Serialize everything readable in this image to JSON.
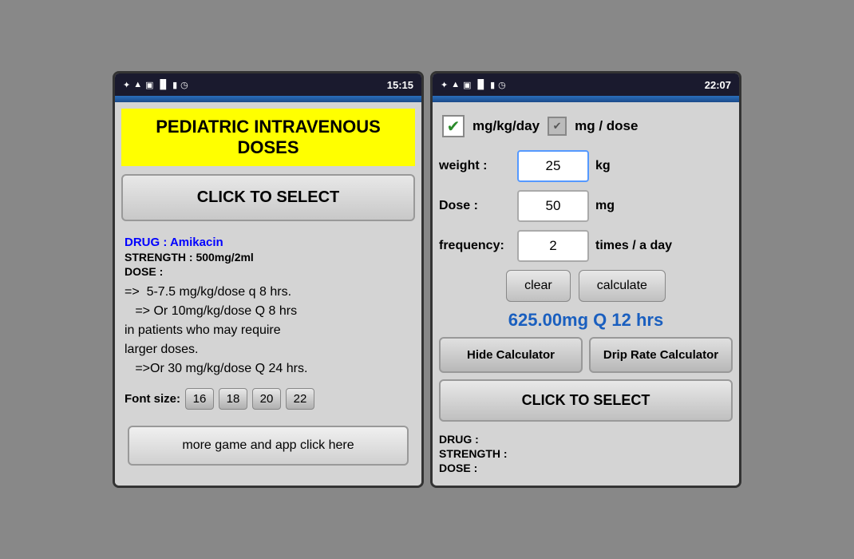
{
  "leftPhone": {
    "statusBar": {
      "time": "15:15",
      "icons": [
        "✦",
        "wifi",
        "☰",
        "▐▐",
        "🔋",
        "⏰"
      ]
    },
    "header": "PEDIATRIC INTRAVENOUS DOSES",
    "selectButton": "CLICK TO SELECT",
    "drug": {
      "labelPrefix": "DRUG : ",
      "drugName": "Amikacin",
      "strength": "STRENGTH : 500mg/2ml",
      "doseLabel": "DOSE :",
      "doseText": "=>  5-7.5 mg/kg/dose q 8 hrs.\n   => Or 10mg/kg/dose Q 8 hrs in patients who may require larger doses.\n   =>Or 30 mg/kg/dose Q 24 hrs."
    },
    "fontSizeLabel": "Font size:",
    "fontSizes": [
      "16",
      "18",
      "20",
      "22"
    ],
    "moreAppsBtn": "more game and app click here"
  },
  "rightPhone": {
    "statusBar": {
      "time": "22:07",
      "icons": [
        "✦",
        "wifi",
        "☰",
        "▐▐",
        "🔋",
        "⏰"
      ]
    },
    "checkboxGreen": "✔",
    "labelMgKgDay": "mg/kg/day",
    "checkboxGray": "✔",
    "labelMgDose": "mg / dose",
    "weightLabel": "weight :",
    "weightValue": "25",
    "weightUnit": "kg",
    "doseLabel": "Dose :",
    "doseValue": "50",
    "doseUnit": "mg",
    "freqLabel": "frequency:",
    "freqValue": "2",
    "freqUnit": "times / a day",
    "clearBtn": "clear",
    "calculateBtn": "calculate",
    "result": "625.00mg Q 12 hrs",
    "hideCalcBtn": "Hide Calculator",
    "dripRateBtn": "Drip Rate Calculator",
    "selectBtn": "CLICK TO SELECT",
    "drugLabel": "DRUG :",
    "strengthLabel": "STRENGTH :",
    "doseLabelBottom": "DOSE :"
  }
}
